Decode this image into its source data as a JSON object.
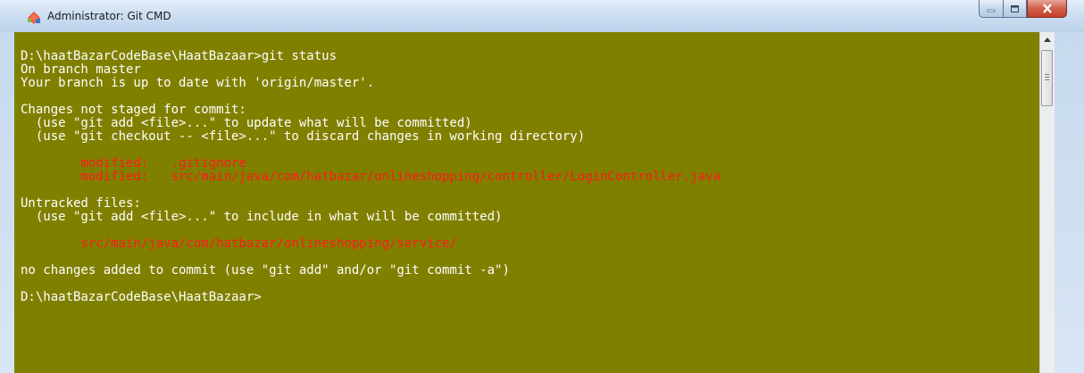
{
  "window": {
    "title": "Administrator: Git CMD",
    "controls": {
      "minimize": "minimize",
      "maximize": "maximize",
      "close": "close"
    }
  },
  "terminal": {
    "background_color": "#808000",
    "text_color": "#ffffff",
    "highlight_color": "#ff1a1a",
    "lines": [
      "D:\\haatBazarCodeBase\\HaatBazaar>git status",
      "On branch master",
      "Your branch is up to date with 'origin/master'.",
      "",
      "Changes not staged for commit:",
      "  (use \"git add <file>...\" to update what will be committed)",
      "  (use \"git checkout -- <file>...\" to discard changes in working directory)",
      "",
      "        modified:   .gitignore",
      "        modified:   src/main/java/com/hatbazar/onlineshopping/controller/LoginController.java",
      "",
      "Untracked files:",
      "  (use \"git add <file>...\" to include in what will be committed)",
      "",
      "        src/main/java/com/hatbazar/onlineshopping/service/",
      "",
      "no changes added to commit (use \"git add\" and/or \"git commit -a\")",
      "",
      "D:\\haatBazarCodeBase\\HaatBazaar>"
    ],
    "red_line_indices": [
      8,
      9,
      14
    ]
  },
  "icons": {
    "app": "git-diamond-icon",
    "scroll_up": "arrow-up-icon"
  }
}
